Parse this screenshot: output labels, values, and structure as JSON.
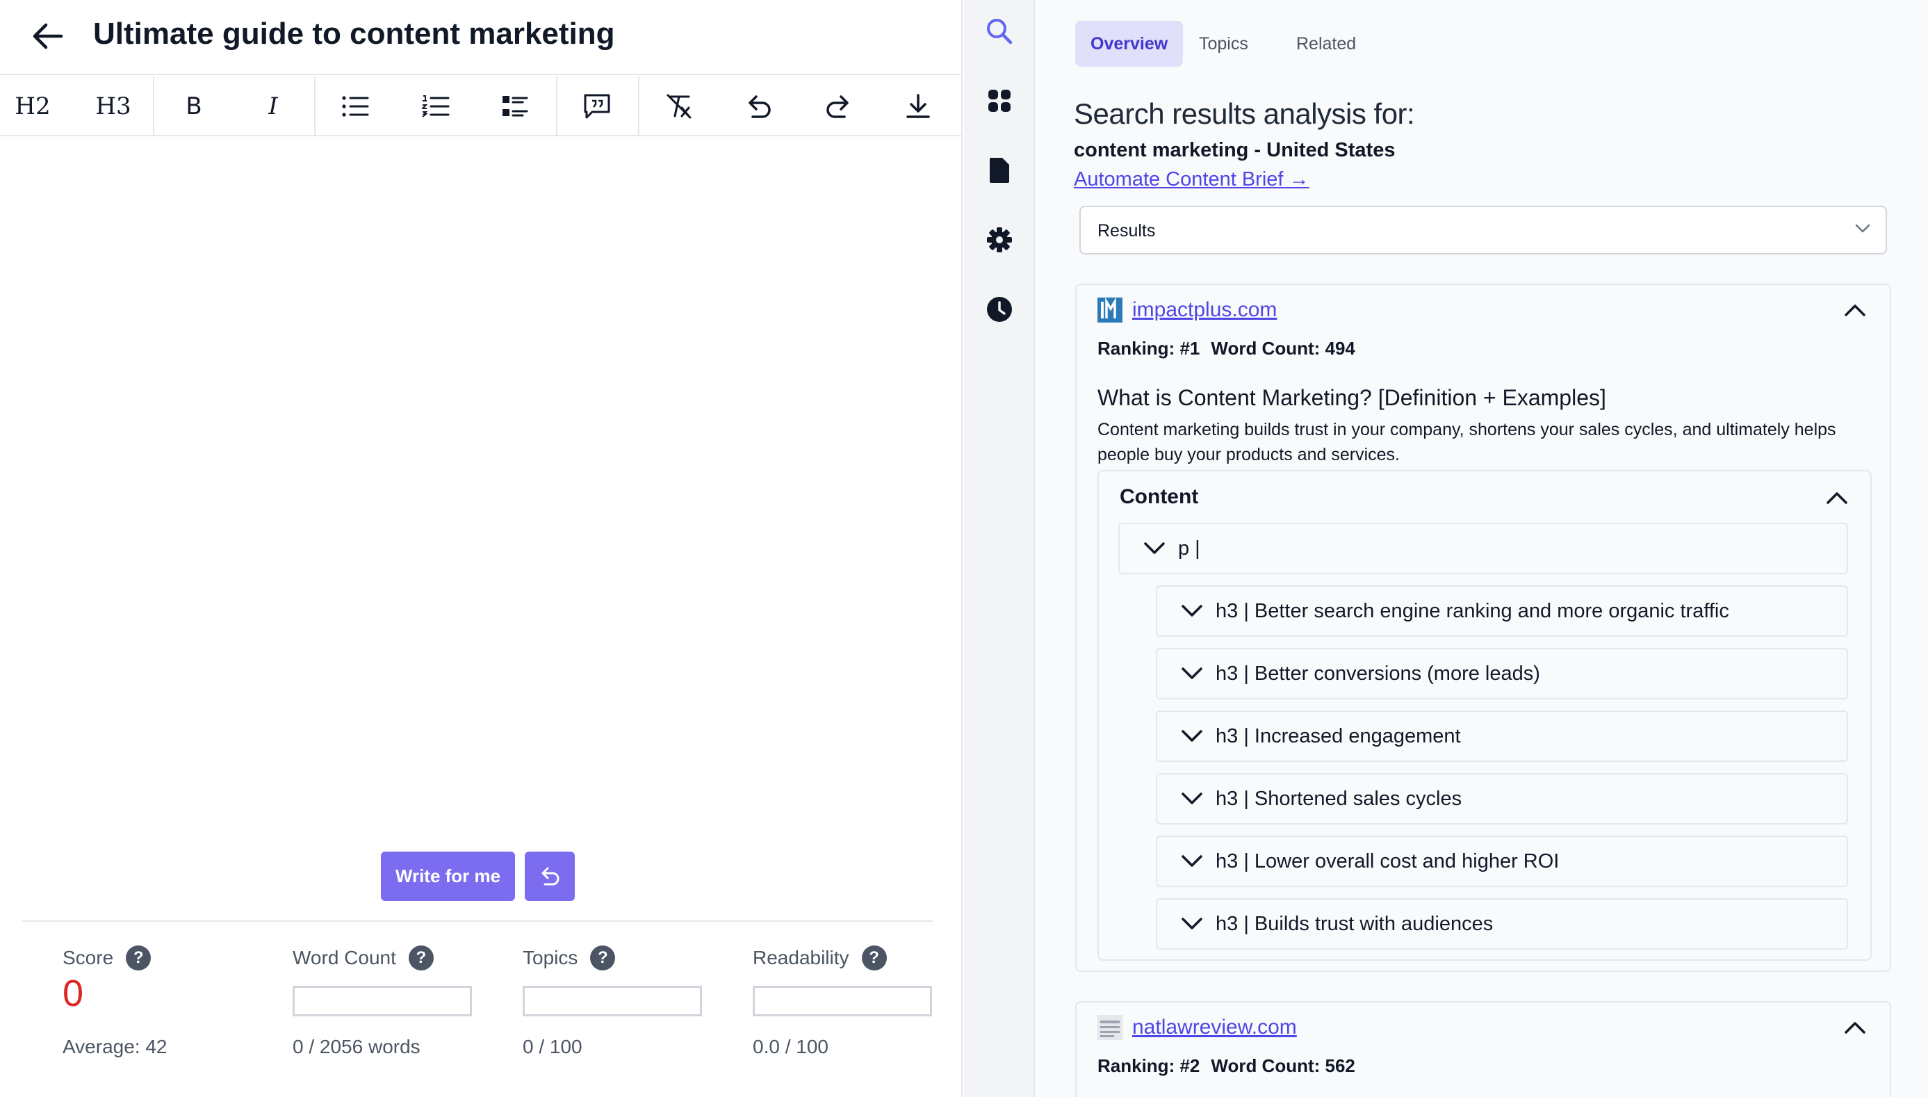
{
  "editor": {
    "title": "Ultimate guide to content marketing",
    "toolbar": {
      "h2": "H2",
      "h3": "H3",
      "bold": "B",
      "italic": "I"
    },
    "write_button": "Write for me"
  },
  "metrics": {
    "score": {
      "label": "Score",
      "value": "0",
      "sub": "Average: 42"
    },
    "word_count": {
      "label": "Word Count",
      "sub": "0 / 2056 words",
      "progress": 0
    },
    "topics": {
      "label": "Topics",
      "sub": "0 / 100",
      "progress": 0
    },
    "readability": {
      "label": "Readability",
      "sub": "0.0 / 100",
      "progress": 0
    },
    "help_glyph": "?"
  },
  "rail": {
    "icons": [
      "search-icon",
      "grid-icon",
      "document-icon",
      "gear-icon",
      "clock-icon"
    ],
    "active_color": "#6366f1"
  },
  "panel": {
    "tabs": [
      {
        "label": "Overview",
        "active": true
      },
      {
        "label": "Topics",
        "active": false
      },
      {
        "label": "Related",
        "active": false
      }
    ],
    "analysis_title": "Search results analysis for:",
    "query": "content marketing - United States",
    "brief_link": "Automate Content Brief",
    "brief_arrow": "→",
    "select_value": "Results",
    "results": [
      {
        "site": "impactplus.com",
        "ranking": "Ranking: #1",
        "word_count": "Word Count: 494",
        "title": "What is Content Marketing? [Definition + Examples]",
        "description": "Content marketing builds trust in your company, shortens your sales cycles, and ultimately helps people buy your products and services.",
        "content_label": "Content",
        "outline": [
          {
            "text": "p |",
            "level": 0
          },
          {
            "text": "h3 | Better search engine ranking and more organic traffic",
            "level": 1
          },
          {
            "text": "h3 | Better conversions (more leads)",
            "level": 1
          },
          {
            "text": "h3 | Increased engagement",
            "level": 1
          },
          {
            "text": "h3 | Shortened sales cycles",
            "level": 1
          },
          {
            "text": "h3 | Lower overall cost and higher ROI",
            "level": 1
          },
          {
            "text": "h3 | Builds trust with audiences",
            "level": 1
          }
        ]
      },
      {
        "site": "natlawreview.com",
        "ranking": "Ranking: #2",
        "word_count": "Word Count: 562"
      }
    ]
  },
  "colors": {
    "accent": "#7c6cf0",
    "link": "#4f46e5",
    "score": "#dc2626"
  }
}
